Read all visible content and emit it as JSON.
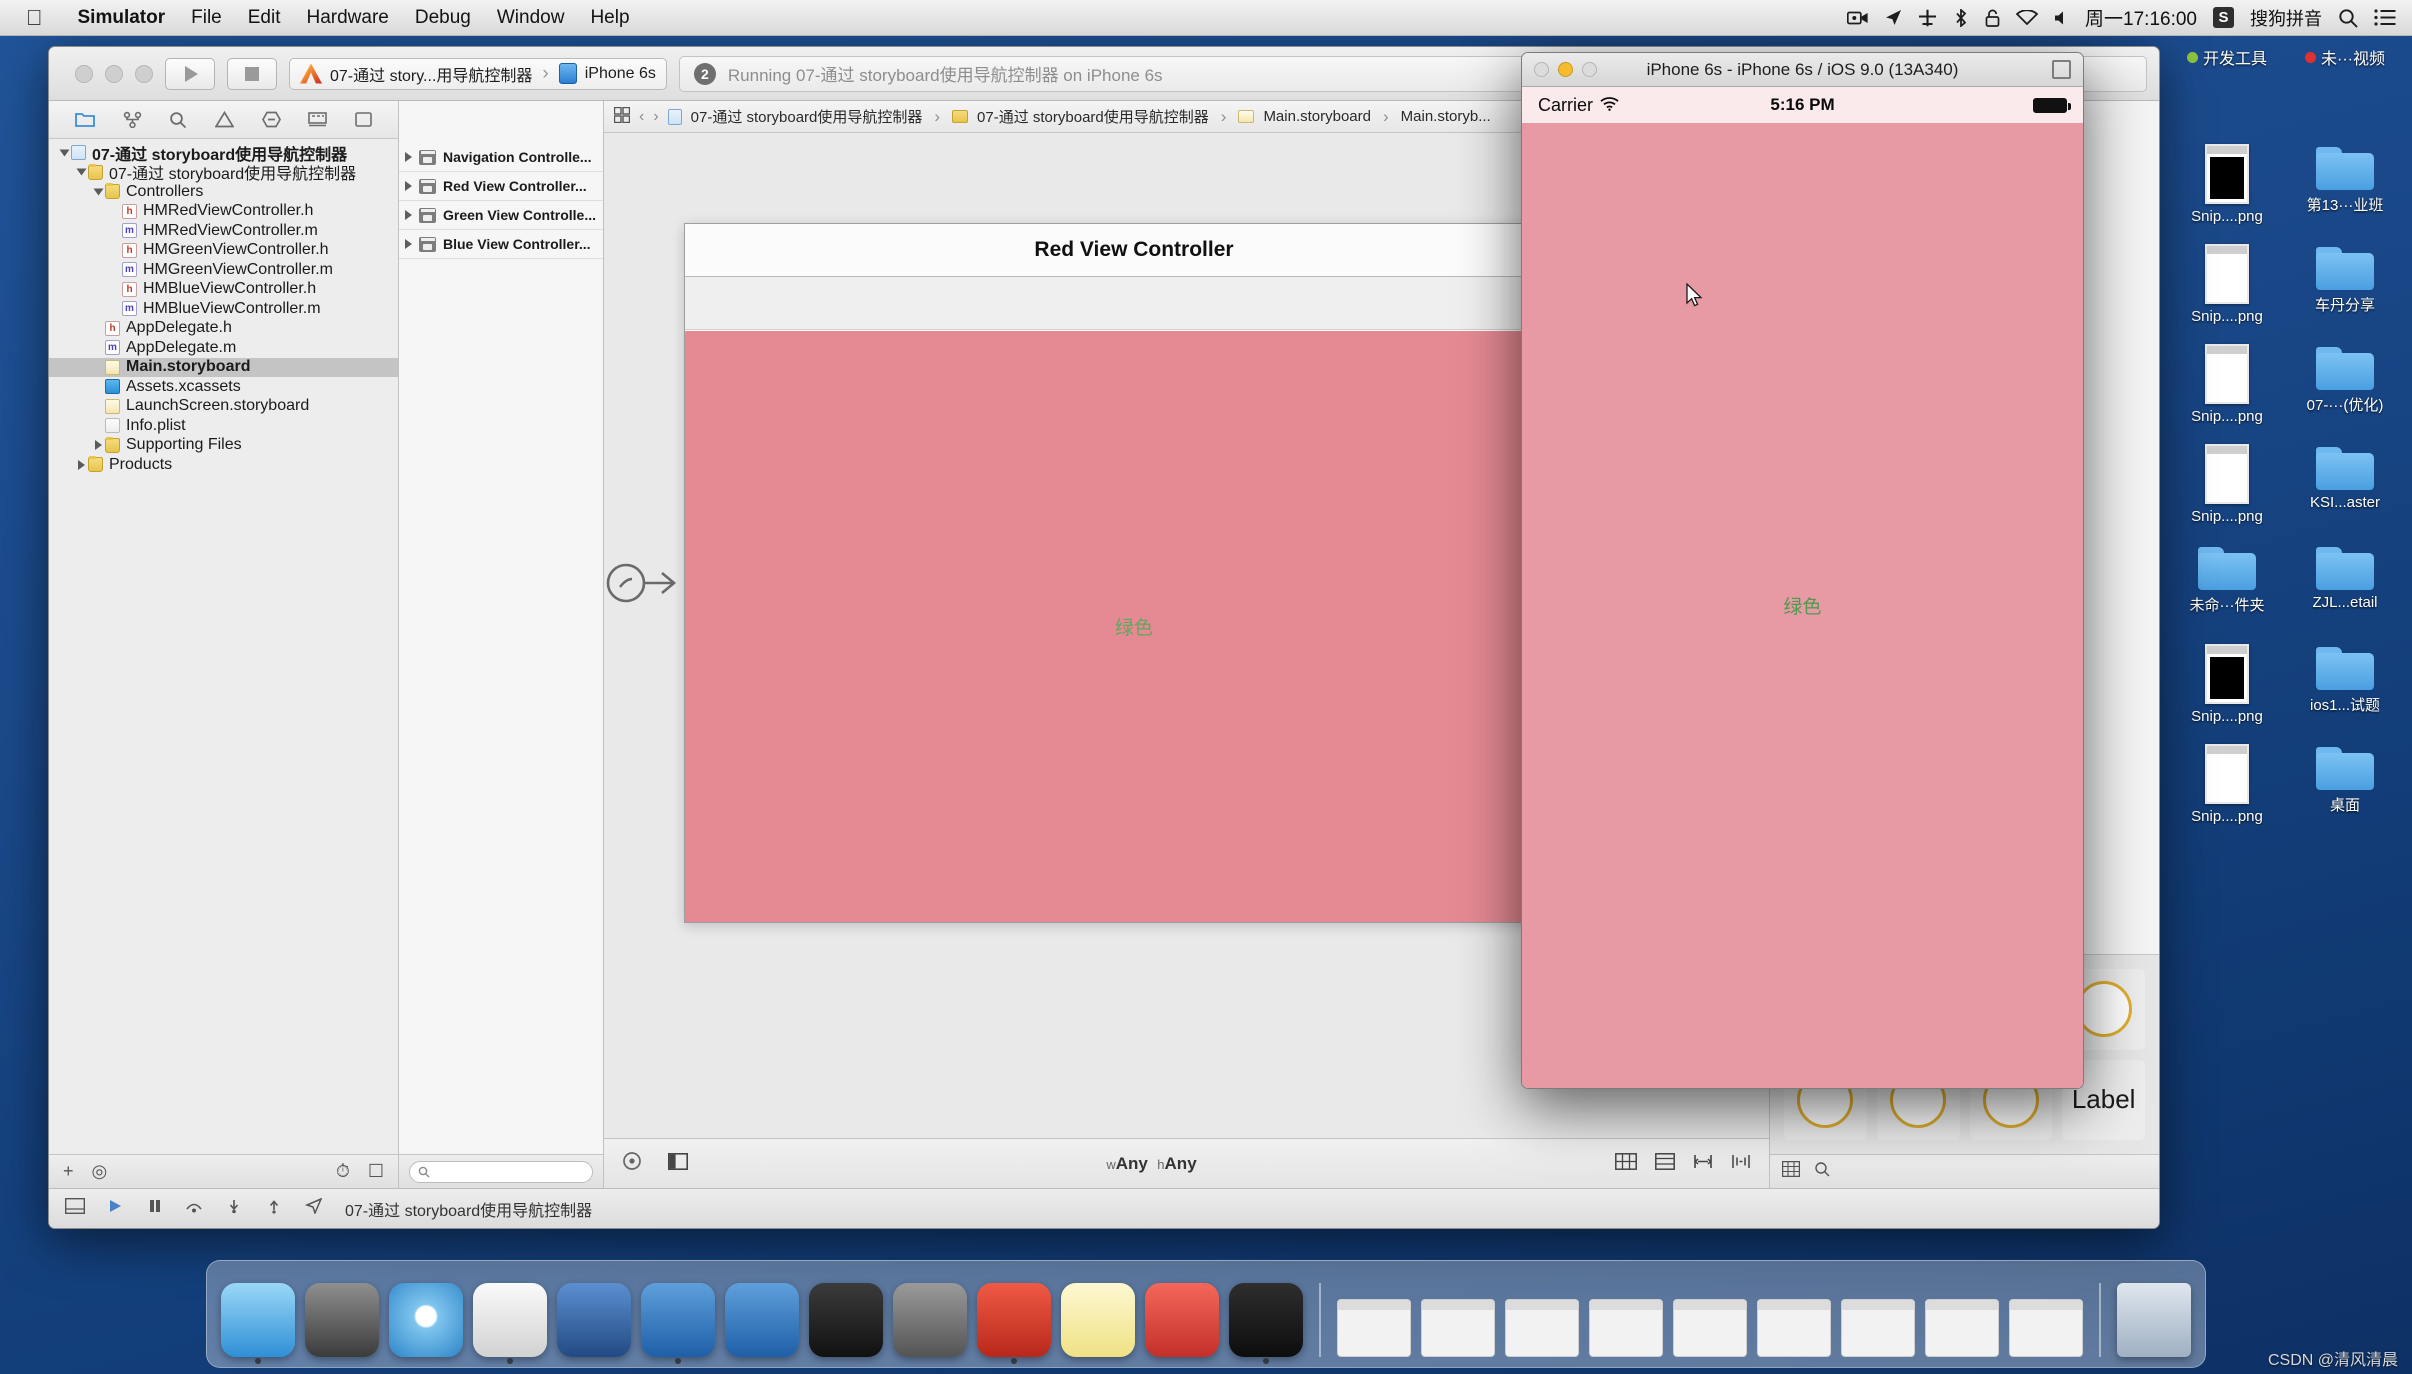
{
  "menubar": {
    "apple_icon": "apple-logo-icon",
    "items": [
      {
        "label": "Simulator",
        "bold": true
      },
      {
        "label": "File",
        "bold": false
      },
      {
        "label": "Edit",
        "bold": false
      },
      {
        "label": "Hardware",
        "bold": false
      },
      {
        "label": "Debug",
        "bold": false
      },
      {
        "label": "Window",
        "bold": false
      },
      {
        "label": "Help",
        "bold": false
      }
    ],
    "status_icons": [
      "screen-record-icon",
      "location-arrow-icon",
      "airplane-icon",
      "bluetooth-icon",
      "lock-icon",
      "wifi-icon",
      "volume-icon"
    ],
    "clock": "周一17:16:00",
    "ime_badge": "S",
    "ime_name": "搜狗拼音",
    "search_icon": "search-icon",
    "notification_icon": "notification-center-icon"
  },
  "xcode": {
    "toolbar": {
      "run_icon": "run-play-icon",
      "stop_icon": "stop-square-icon",
      "scheme": "07-通过 story...用导航控制器",
      "destination": "iPhone 6s",
      "activity_count": "2",
      "activity_text": "Running 07-通过 storyboard使用导航控制器 on iPhone 6s"
    },
    "navigator": {
      "tabs": [
        "folder-icon",
        "source-control-icon",
        "search-icon",
        "warning-icon",
        "breakpoint-icon",
        "report-icon",
        "test-icon"
      ],
      "tree": [
        {
          "label": "07-通过 storyboard使用导航控制器",
          "depth": 0,
          "icon": "project",
          "twisty": "open",
          "bold": true
        },
        {
          "label": "07-通过 storyboard使用导航控制器",
          "depth": 1,
          "icon": "folder",
          "twisty": "open",
          "bold": false
        },
        {
          "label": "Controllers",
          "depth": 2,
          "icon": "folder",
          "twisty": "open",
          "bold": false
        },
        {
          "label": "HMRedViewController.h",
          "depth": 3,
          "icon": "h",
          "twisty": "none",
          "bold": false
        },
        {
          "label": "HMRedViewController.m",
          "depth": 3,
          "icon": "m",
          "twisty": "none",
          "bold": false
        },
        {
          "label": "HMGreenViewController.h",
          "depth": 3,
          "icon": "h",
          "twisty": "none",
          "bold": false
        },
        {
          "label": "HMGreenViewController.m",
          "depth": 3,
          "icon": "m",
          "twisty": "none",
          "bold": false
        },
        {
          "label": "HMBlueViewController.h",
          "depth": 3,
          "icon": "h",
          "twisty": "none",
          "bold": false
        },
        {
          "label": "HMBlueViewController.m",
          "depth": 3,
          "icon": "m",
          "twisty": "none",
          "bold": false
        },
        {
          "label": "AppDelegate.h",
          "depth": 2,
          "icon": "h",
          "twisty": "none",
          "bold": false
        },
        {
          "label": "AppDelegate.m",
          "depth": 2,
          "icon": "m",
          "twisty": "none",
          "bold": false
        },
        {
          "label": "Main.storyboard",
          "depth": 2,
          "icon": "storyboard",
          "twisty": "none",
          "bold": true,
          "selected": true
        },
        {
          "label": "Assets.xcassets",
          "depth": 2,
          "icon": "xcassets",
          "twisty": "none",
          "bold": false
        },
        {
          "label": "LaunchScreen.storyboard",
          "depth": 2,
          "icon": "storyboard",
          "twisty": "none",
          "bold": false
        },
        {
          "label": "Info.plist",
          "depth": 2,
          "icon": "plist",
          "twisty": "none",
          "bold": false
        },
        {
          "label": "Supporting Files",
          "depth": 2,
          "icon": "folder",
          "twisty": "closed",
          "bold": false
        },
        {
          "label": "Products",
          "depth": 1,
          "icon": "folder",
          "twisty": "closed",
          "bold": false
        }
      ],
      "footer_icons": [
        "add-icon",
        "filter-icon",
        "recent-icon",
        "unsaved-icon"
      ]
    },
    "outline": {
      "items": [
        {
          "label": "Navigation Controlle...",
          "icon": "view-controller-icon"
        },
        {
          "label": "Red View Controller...",
          "icon": "view-controller-icon"
        },
        {
          "label": "Green View Controlle...",
          "icon": "view-controller-icon"
        },
        {
          "label": "Blue View Controller...",
          "icon": "view-controller-icon"
        }
      ],
      "search_placeholder": ""
    },
    "breadcrumb": {
      "grid_icon": "assistant-grid-icon",
      "back_icon": "chevron-left-icon",
      "forward_icon": "chevron-right-icon",
      "items": [
        "07-通过 storyboard使用导航控制器",
        "07-通过 storyboard使用导航控制器",
        "Main.storyboard",
        "Main.storyb..."
      ]
    },
    "canvas": {
      "scene_title": "Red View Controller",
      "scene_body_text": "绿色",
      "entry_point_icon": "storyboard-entry-point-icon"
    },
    "canvas_footer": {
      "zoom_icon": "zoom-icon",
      "panel_icon": "panel-toggle-icon",
      "size_class_w": "w",
      "size_class_w_value": "Any",
      "size_class_h": "h",
      "size_class_h_value": "Any",
      "right_icons": [
        "constraints-icon",
        "align-icon",
        "pin-icon",
        "resolve-icon"
      ]
    },
    "status_bar": {
      "icons": [
        "console-icon",
        "run-icon",
        "pause-icon",
        "home-icon",
        "step-icon",
        "location-icon"
      ],
      "scheme_text": "07-通过 storyboard使用导航控制器"
    },
    "library": {
      "label_item": "Label",
      "object_count": 8
    }
  },
  "simulator": {
    "title": "iPhone 6s - iPhone 6s / iOS 9.0 (13A340)",
    "status": {
      "carrier": "Carrier",
      "wifi_icon": "wifi-icon",
      "time": "5:16 PM",
      "battery_icon": "battery-full-icon"
    },
    "screen_text": "绿色",
    "screen_color": "#e79aa4",
    "cursor_icon": "mouse-pointer-icon"
  },
  "desktop": {
    "tags": [
      {
        "label": "开发工具",
        "color": "#8cc63f"
      },
      {
        "label": "未···视频",
        "color": "#e03131"
      }
    ],
    "icons": [
      {
        "label": "Snip....png",
        "type": "thumb-black"
      },
      {
        "label": "第13···业班",
        "type": "folder"
      },
      {
        "label": "Snip....png",
        "type": "thumb-light"
      },
      {
        "label": "车丹分享",
        "type": "folder"
      },
      {
        "label": "Snip....png",
        "type": "thumb-light"
      },
      {
        "label": "07-···(优化)",
        "type": "folder"
      },
      {
        "label": "Snip....png",
        "type": "thumb-light"
      },
      {
        "label": "KSI...aster",
        "type": "folder"
      },
      {
        "label": "未命···件夹",
        "type": "folder"
      },
      {
        "label": "ZJL...etail",
        "type": "folder"
      },
      {
        "label": "Snip....png",
        "type": "thumb-black"
      },
      {
        "label": "ios1...试题",
        "type": "folder"
      },
      {
        "label": "Snip....png",
        "type": "thumb-light"
      },
      {
        "label": "桌面",
        "type": "folder"
      }
    ]
  },
  "dock": {
    "apps": [
      {
        "name": "finder-icon",
        "color1": "#6cc4f5",
        "color2": "#2b8fd6",
        "running": false
      },
      {
        "name": "launchpad-icon",
        "color1": "#6b6b6b",
        "color2": "#3a3a3a",
        "running": false
      },
      {
        "name": "safari-icon",
        "color1": "#9fd8f7",
        "color2": "#3a8fd0",
        "running": false
      },
      {
        "name": "simulator-icon",
        "color1": "#f5f5f5",
        "color2": "#d8d8d8",
        "running": true
      },
      {
        "name": "video-icon",
        "color1": "#4a7fc1",
        "color2": "#24477e",
        "running": false
      },
      {
        "name": "xcode-icon",
        "color1": "#4c8ed4",
        "color2": "#1f5fa8",
        "running": true
      },
      {
        "name": "xcode-beta-icon",
        "color1": "#4c8ed4",
        "color2": "#1f5fa8",
        "running": false
      },
      {
        "name": "terminal-icon",
        "color1": "#3a3a3a",
        "color2": "#111111",
        "running": false
      },
      {
        "name": "system-preferences-icon",
        "color1": "#8e8e8e",
        "color2": "#555555",
        "running": false
      },
      {
        "name": "charles-icon",
        "color1": "#e64a3a",
        "color2": "#b8281a",
        "running": true
      },
      {
        "name": "notes-icon",
        "color1": "#fdf6c8",
        "color2": "#f2e48a",
        "running": false
      },
      {
        "name": "keynote-icon",
        "color1": "#f0554a",
        "color2": "#c3302a",
        "running": false
      },
      {
        "name": "app-icon",
        "color1": "#2a2a2a",
        "color2": "#0d0d0d",
        "running": false
      }
    ],
    "windows_count": 9,
    "trash_icon": "trash-icon"
  },
  "watermark": "CSDN @清风清晨"
}
